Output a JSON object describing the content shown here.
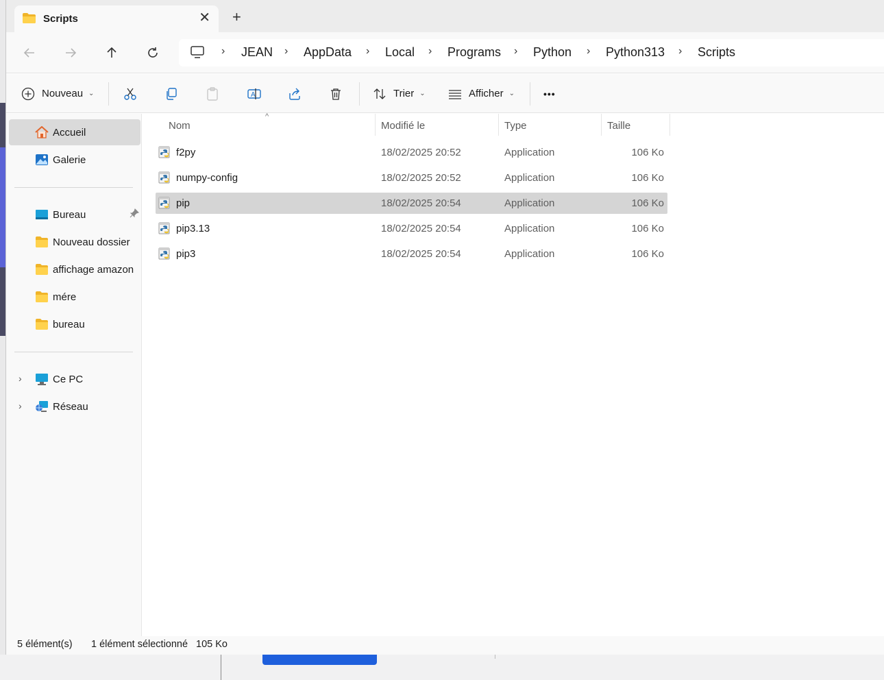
{
  "tab": {
    "title": "Scripts",
    "close": "✕",
    "new": "+"
  },
  "breadcrumb": [
    "JEAN",
    "AppData",
    "Local",
    "Programs",
    "Python",
    "Python313",
    "Scripts"
  ],
  "breadcrumb_sep": "›",
  "toolbar": {
    "new_label": "Nouveau",
    "sort_label": "Trier",
    "view_label": "Afficher",
    "more": "•••",
    "caret": "⌄"
  },
  "sidebar": {
    "items": [
      {
        "label": "Accueil",
        "icon": "home-icon"
      },
      {
        "label": "Galerie",
        "icon": "gallery-icon"
      },
      {
        "label": "Bureau",
        "icon": "desktop-icon",
        "pin": "📌"
      },
      {
        "label": "Nouveau dossier",
        "icon": "folder-icon"
      },
      {
        "label": "affichage amazon",
        "icon": "folder-icon"
      },
      {
        "label": "mére",
        "icon": "folder-icon"
      },
      {
        "label": "bureau",
        "icon": "folder-icon"
      },
      {
        "label": "Ce PC",
        "icon": "pc-icon"
      },
      {
        "label": "Réseau",
        "icon": "network-icon"
      }
    ],
    "chevron": "›"
  },
  "columns": {
    "name": "Nom",
    "modified": "Modifié le",
    "type": "Type",
    "size": "Taille",
    "sort_caret": "^"
  },
  "files": [
    {
      "name": "f2py",
      "modified": "18/02/2025 20:52",
      "type": "Application",
      "size": "106 Ko"
    },
    {
      "name": "numpy-config",
      "modified": "18/02/2025 20:52",
      "type": "Application",
      "size": "106 Ko"
    },
    {
      "name": "pip",
      "modified": "18/02/2025 20:54",
      "type": "Application",
      "size": "106 Ko"
    },
    {
      "name": "pip3.13",
      "modified": "18/02/2025 20:54",
      "type": "Application",
      "size": "106 Ko"
    },
    {
      "name": "pip3",
      "modified": "18/02/2025 20:54",
      "type": "Application",
      "size": "106 Ko"
    }
  ],
  "selected_file": "pip",
  "status": {
    "count": "5 élément(s)",
    "selection": "1 élément sélectionné",
    "size": "105 Ko"
  },
  "colors": {
    "accent": "#1e5fdc",
    "selection": "#d5d5d5",
    "folder": "#f5c542"
  }
}
